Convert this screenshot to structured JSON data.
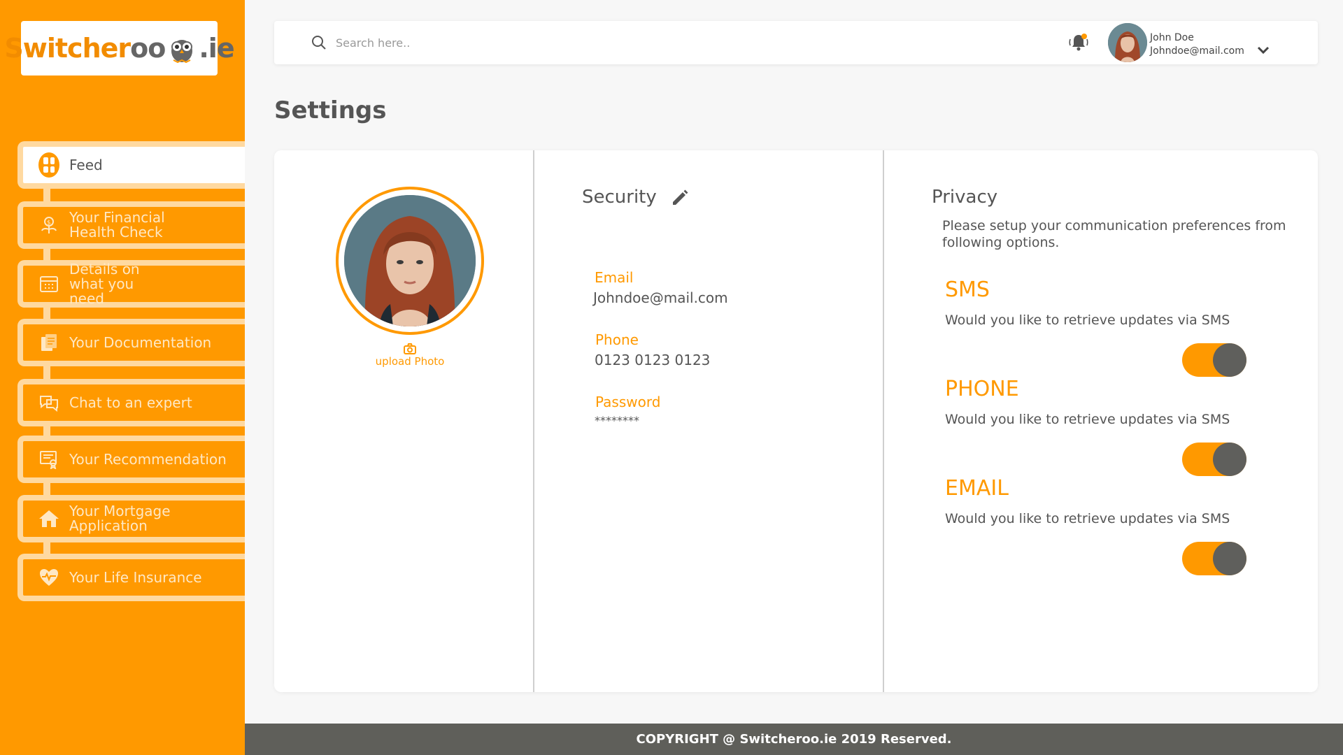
{
  "brand": {
    "name_orange": "Switcher",
    "name_tail": "oo",
    "name_domain": ".ie",
    "accent": "#ff9900",
    "logo_icon": "owl-icon"
  },
  "sidebar": {
    "items": [
      {
        "label": "Feed",
        "icon": "grid-icon",
        "active": true
      },
      {
        "label": "Your Financial Health Check",
        "icon": "money-plant-icon"
      },
      {
        "label": "Details on what you need",
        "icon": "calendar-icon"
      },
      {
        "label": "Your Documentation",
        "icon": "documents-icon"
      },
      {
        "label": "Chat to an expert",
        "icon": "chat-icon"
      },
      {
        "label": "Your Recommendation",
        "icon": "certificate-icon"
      },
      {
        "label": "Your Mortgage Application",
        "icon": "house-icon"
      },
      {
        "label": "Your Life Insurance",
        "icon": "heart-hand-icon"
      }
    ]
  },
  "header": {
    "search_placeholder": "Search here..",
    "user_name": "John Doe",
    "user_email": "Johndoe@mail.com"
  },
  "page": {
    "title": "Settings"
  },
  "profile": {
    "upload_label": "upload Photo"
  },
  "security": {
    "title": "Security",
    "email_label": "Email",
    "email_value": "Johndoe@mail.com",
    "phone_label": "Phone",
    "phone_value": "0123 0123 0123",
    "password_label": "Password",
    "password_value": "********"
  },
  "privacy": {
    "title": "Privacy",
    "description": "Please setup your communication preferences from following options.",
    "prefs": [
      {
        "title": "SMS",
        "description": "Would you like to retrieve updates via SMS",
        "enabled": true
      },
      {
        "title": "PHONE",
        "description": "Would you like to retrieve updates via SMS",
        "enabled": true
      },
      {
        "title": "EMAIL",
        "description": "Would you like to retrieve updates via SMS",
        "enabled": true
      }
    ]
  },
  "footer": {
    "text": "COPYRIGHT @ Switcheroo.ie 2019 Reserved."
  }
}
